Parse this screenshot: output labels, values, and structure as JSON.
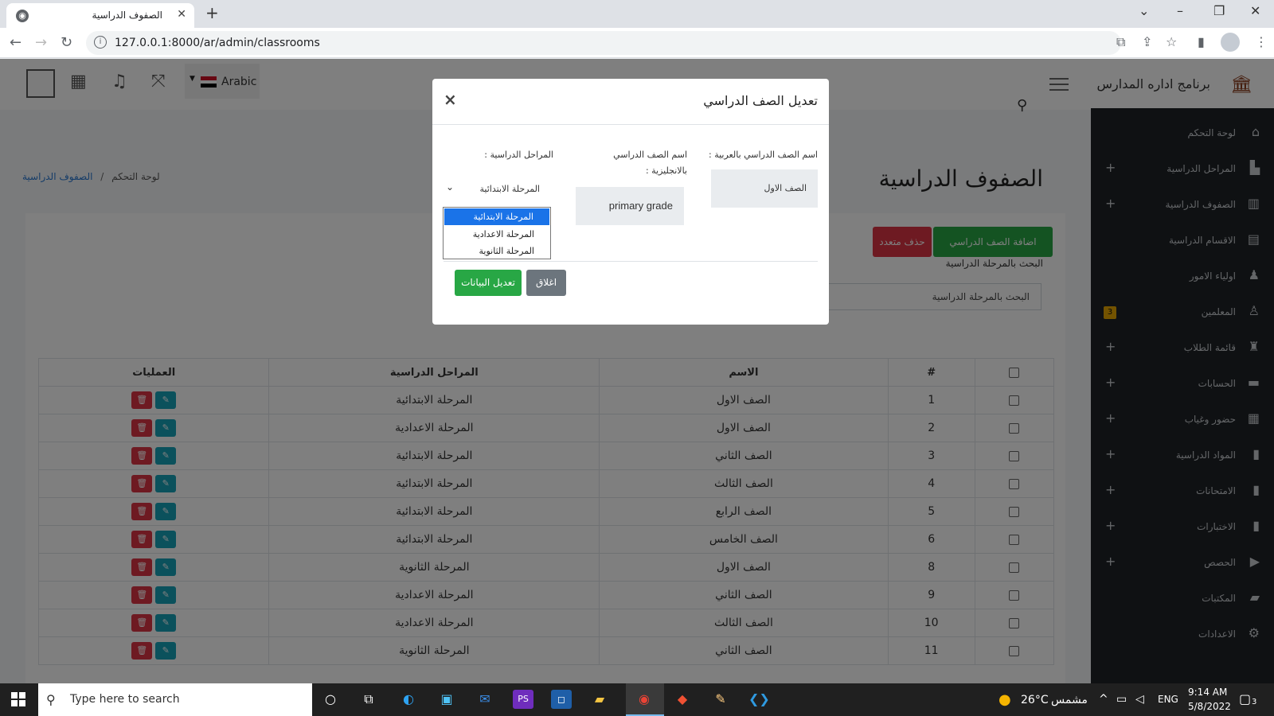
{
  "browser": {
    "tab_title": "الصفوف الدراسية",
    "new_tab": "+",
    "url": "127.0.0.1:8000/ar/admin/classrooms"
  },
  "topbar": {
    "language": "Arabic",
    "brand": "برنامج اداره المدارس"
  },
  "sidebar": {
    "items": [
      {
        "label": "لوحة التحكم",
        "icon": "home-icon",
        "plus": false,
        "badge": ""
      },
      {
        "label": "المراحل الدراسية",
        "icon": "building-icon",
        "plus": true,
        "badge": ""
      },
      {
        "label": "الصفوف الدراسية",
        "icon": "school-icon",
        "plus": true,
        "badge": ""
      },
      {
        "label": "الاقسام الدراسية",
        "icon": "section-icon",
        "plus": false,
        "badge": ""
      },
      {
        "label": "اولياء الامور",
        "icon": "parent-icon",
        "plus": false,
        "badge": ""
      },
      {
        "label": "المعلمين",
        "icon": "teacher-icon",
        "plus": false,
        "badge": "3"
      },
      {
        "label": "قائمة الطلاب",
        "icon": "student-icon",
        "plus": true,
        "badge": ""
      },
      {
        "label": "الحسابات",
        "icon": "money-icon",
        "plus": true,
        "badge": ""
      },
      {
        "label": "حضور وغياب",
        "icon": "calendar-icon",
        "plus": true,
        "badge": ""
      },
      {
        "label": "المواد الدراسية",
        "icon": "book-icon",
        "plus": true,
        "badge": ""
      },
      {
        "label": "الامتحانات",
        "icon": "exam-icon",
        "plus": true,
        "badge": ""
      },
      {
        "label": "الاختبارات",
        "icon": "quiz-icon",
        "plus": true,
        "badge": ""
      },
      {
        "label": "الحصص",
        "icon": "video-icon",
        "plus": true,
        "badge": ""
      },
      {
        "label": "المكتبات",
        "icon": "library-icon",
        "plus": false,
        "badge": ""
      },
      {
        "label": "الاعدادات",
        "icon": "settings-icon",
        "plus": false,
        "badge": ""
      }
    ]
  },
  "breadcrumb": {
    "home": "لوحة التحكم",
    "sep": "/",
    "current": "الصفوف الدراسية"
  },
  "page_title": "الصفوف الدراسية",
  "buttons": {
    "add": "اضافة الصف الدراسي",
    "bulk_delete": "حذف متعدد"
  },
  "filter": {
    "label": "البحث بالمرحلة الدراسية",
    "placeholder": "البحث بالمرحلة الدراسية"
  },
  "table": {
    "headers": {
      "num": "#",
      "name": "الاسم",
      "stage": "المراحل الدراسية",
      "actions": "العمليات"
    },
    "rows": [
      {
        "num": "1",
        "name": "الصف الاول",
        "stage": "المرحلة الابتدائية"
      },
      {
        "num": "2",
        "name": "الصف الاول",
        "stage": "المرحلة الاعدادية"
      },
      {
        "num": "3",
        "name": "الصف الثاني",
        "stage": "المرحلة الابتدائية"
      },
      {
        "num": "4",
        "name": "الصف الثالث",
        "stage": "المرحلة الابتدائية"
      },
      {
        "num": "5",
        "name": "الصف الرابع",
        "stage": "المرحلة الابتدائية"
      },
      {
        "num": "6",
        "name": "الصف الخامس",
        "stage": "المرحلة الابتدائية"
      },
      {
        "num": "8",
        "name": "الصف الاول",
        "stage": "المرحلة الثانوية"
      },
      {
        "num": "9",
        "name": "الصف الثاني",
        "stage": "المرحلة الاعدادية"
      },
      {
        "num": "10",
        "name": "الصف الثالث",
        "stage": "المرحلة الاعدادية"
      },
      {
        "num": "11",
        "name": "الصف الثاني",
        "stage": "المرحلة الثانوية"
      }
    ]
  },
  "modal": {
    "title": "تعديل الصف الدراسي",
    "close": "×",
    "label_ar": "اسم الصف الدراسي بالعربية :",
    "value_ar": "الصف الاول",
    "label_en_line1": "اسم الصف الدراسي",
    "label_en_line2": "بالانجليزية :",
    "value_en": "primary grade",
    "label_stage": "المراحل الدراسية :",
    "selected_stage": "المرحلة الابتدائية",
    "stage_options": [
      "المرحلة الابتدائية",
      "المرحلة الاعدادية",
      "المرحلة الثانوية"
    ],
    "btn_close": "اغلاق",
    "btn_save": "تعديل البيانات"
  },
  "taskbar": {
    "search_placeholder": "Type here to search",
    "temperature": "26°C",
    "weather": "مشمس",
    "lang": "ENG",
    "time": "9:14 AM",
    "date": "5/8/2022",
    "notifications": "3"
  }
}
